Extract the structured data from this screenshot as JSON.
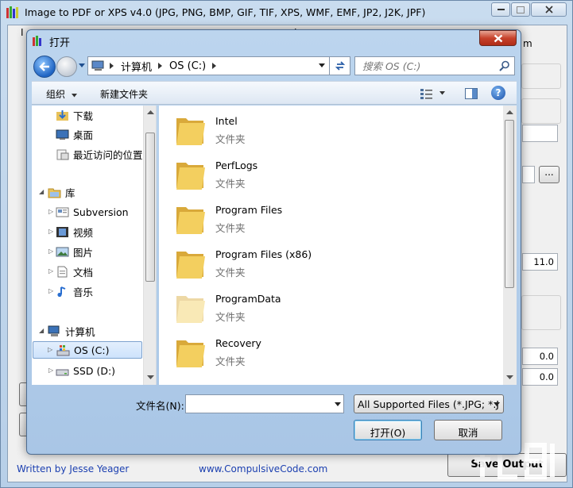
{
  "main": {
    "title": "Image to PDF or XPS  v4.0   (JPG, PNG, BMP, GIF, TIF, XPS, WMF, EMF, JP2, J2K, JPF)",
    "fragments": {
      "left_label_fragment": "I",
      "center_label_fragment": "I",
      "right_fragment": "m"
    },
    "values": {
      "v1": "11.0",
      "v2": "0.0",
      "v3": "0.0"
    },
    "browse_label": "...",
    "footer_author": "Written by Jesse Yeager",
    "footer_site": "www.CompulsiveCode.com",
    "save_output": "Save Output"
  },
  "dialog": {
    "title": "打开",
    "breadcrumb": [
      "计算机",
      "OS (C:)"
    ],
    "search_placeholder": "搜索 OS (C:)",
    "toolbar": {
      "organize": "组织",
      "new_folder": "新建文件夹",
      "help": "?"
    },
    "nav": {
      "downloads": "下载",
      "desktop": "桌面",
      "recent": "最近访问的位置",
      "libraries": "库",
      "subversion": "Subversion",
      "videos": "视频",
      "pictures": "图片",
      "documents": "文档",
      "music": "音乐",
      "computer": "计算机",
      "os_c": "OS (C:)",
      "ssd_d": "SSD (D:)"
    },
    "files": [
      {
        "name": "Intel",
        "type": "文件夹"
      },
      {
        "name": "PerfLogs",
        "type": "文件夹"
      },
      {
        "name": "Program Files",
        "type": "文件夹"
      },
      {
        "name": "Program Files (x86)",
        "type": "文件夹"
      },
      {
        "name": "ProgramData",
        "type": "文件夹"
      },
      {
        "name": "Recovery",
        "type": "文件夹"
      }
    ],
    "filename_label": "文件名(N):",
    "filename_value": "",
    "filetype": "All Supported Files (*.JPG; *.J",
    "open": "打开(O)",
    "cancel": "取消"
  },
  "colors": {
    "accent": "#1f64c3",
    "link": "#1b3fb0",
    "close": "#c7422c",
    "folder": "#f3cf5f"
  }
}
